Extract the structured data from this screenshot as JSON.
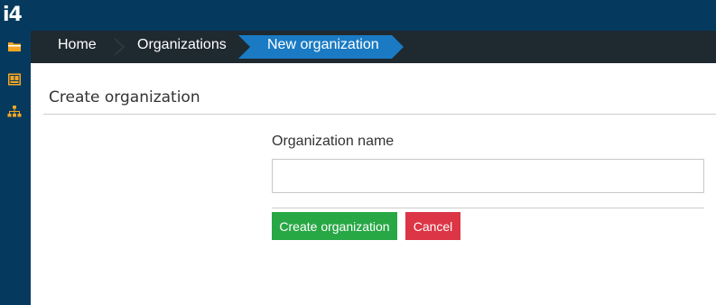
{
  "app": {
    "logo_text": "i4"
  },
  "sidebar": {
    "items": [
      {
        "icon": "folder-icon",
        "color": "#f5a623"
      },
      {
        "icon": "id-card-icon",
        "color": "#f5a623"
      },
      {
        "icon": "org-chart-icon",
        "color": "#f5a623"
      }
    ]
  },
  "breadcrumb": {
    "items": [
      {
        "label": "Home"
      },
      {
        "label": "Organizations"
      },
      {
        "label": "New organization",
        "active": true
      }
    ]
  },
  "page": {
    "title": "Create organization"
  },
  "form": {
    "name_label": "Organization name",
    "name_value": "",
    "name_placeholder": "",
    "submit_label": "Create organization",
    "cancel_label": "Cancel"
  },
  "colors": {
    "header": "#053a5e",
    "breadcrumb_bg": "#1f2930",
    "breadcrumb_active": "#1a7bc4",
    "create_button": "#28a745",
    "cancel_button": "#dc3545"
  }
}
